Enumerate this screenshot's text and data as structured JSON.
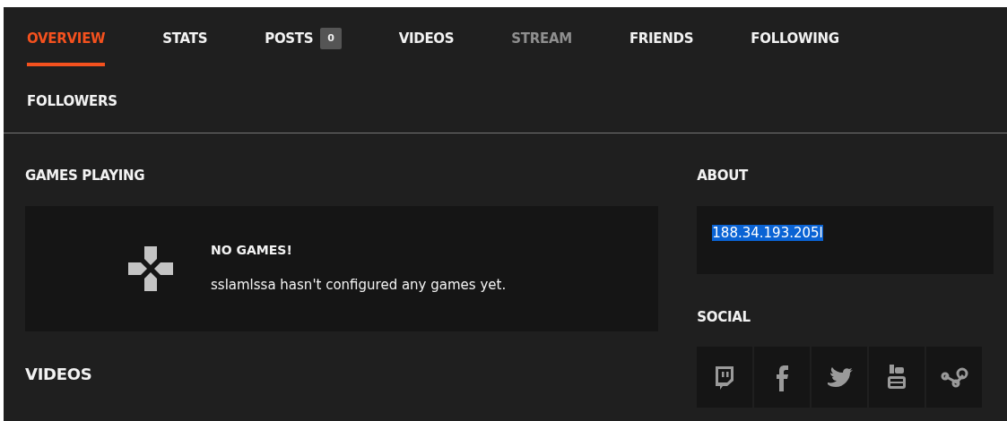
{
  "tabs": [
    {
      "label": "OVERVIEW",
      "selected": true,
      "disabled": false
    },
    {
      "label": "STATS",
      "selected": false,
      "disabled": false
    },
    {
      "label": "POSTS",
      "selected": false,
      "disabled": false,
      "count": "0"
    },
    {
      "label": "VIDEOS",
      "selected": false,
      "disabled": false
    },
    {
      "label": "STREAM",
      "selected": false,
      "disabled": true
    },
    {
      "label": "FRIENDS",
      "selected": false,
      "disabled": false
    },
    {
      "label": "FOLLOWING",
      "selected": false,
      "disabled": false
    },
    {
      "label": "FOLLOWERS",
      "selected": false,
      "disabled": false
    }
  ],
  "games_playing": {
    "title": "GAMES PLAYING",
    "heading": "NO GAMES!",
    "message": "sslamlssa hasn't configured any games yet."
  },
  "videos": {
    "title": "VIDEOS"
  },
  "about": {
    "title": "ABOUT",
    "text": "188.34.193.205l",
    "text_selected": true
  },
  "social": {
    "title": "SOCIAL",
    "links": [
      {
        "kind": "twitch"
      },
      {
        "kind": "facebook"
      },
      {
        "kind": "twitter"
      },
      {
        "kind": "youtube"
      },
      {
        "kind": "steam"
      }
    ]
  }
}
